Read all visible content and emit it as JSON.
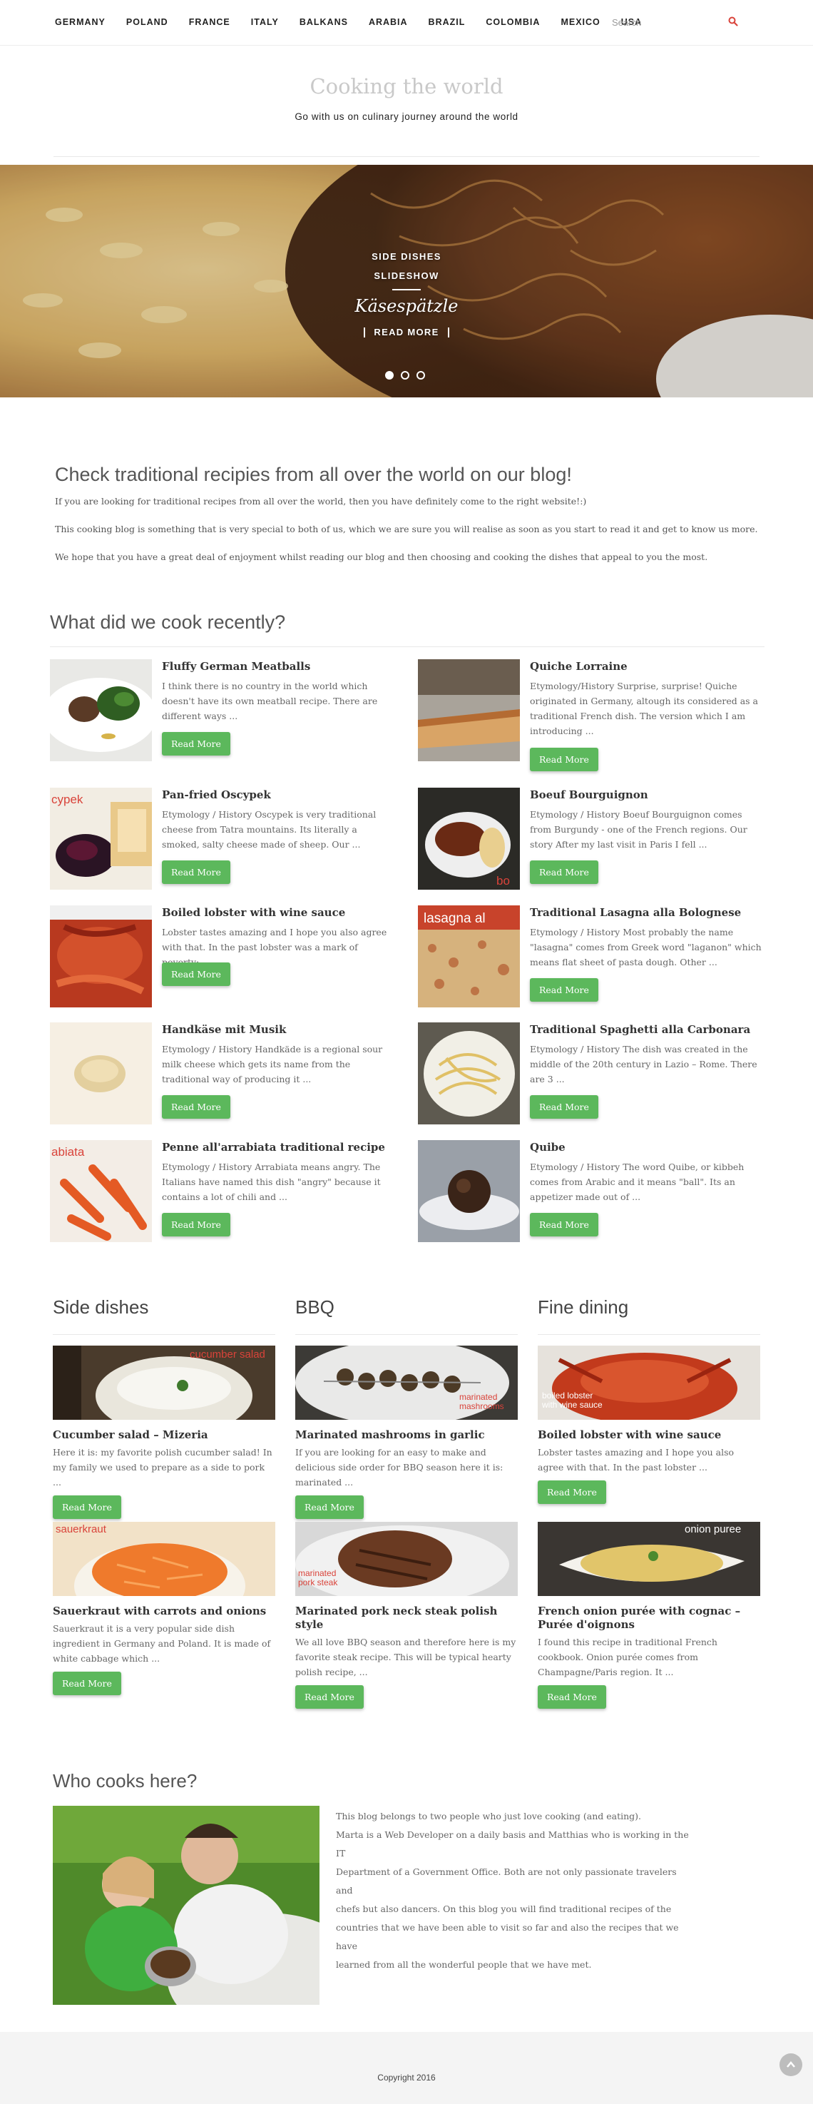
{
  "nav": {
    "items": [
      "GERMANY",
      "POLAND",
      "FRANCE",
      "ITALY",
      "BALKANS",
      "ARABIA",
      "BRAZIL",
      "COLOMBIA",
      "MEXICO",
      "USA"
    ],
    "search_placeholder": "Search",
    "search_icon": "search-icon"
  },
  "header": {
    "title": "Cooking the world",
    "tagline": "Go with us on culinary journey around the world"
  },
  "hero": {
    "category_1": "SIDE DISHES",
    "category_2": "SLIDESHOW",
    "title": "Käsespätzle",
    "read_more": "READ MORE",
    "slide_count": 3,
    "active_slide": 1
  },
  "intro": {
    "heading": "Check traditional recipies from all over the world on our blog!",
    "p1": "If you are looking for traditional recipes from all over the world, then you have definitely come to the right website!:)",
    "p2": "This cooking blog is something that is very special to both of us, which we are sure you will realise as soon as you start to read it and get to know us more.",
    "p3": "We hope that you have a great deal of enjoyment whilst reading our blog and then choosing and cooking the dishes that appeal to you the most."
  },
  "recent": {
    "heading": "What did we cook recently?",
    "button_label": "Read More",
    "left": [
      {
        "title": "Fluffy German Meatballs",
        "text": "I think there is no country in the world which doesn't have its own meatball recipe. There are different ways ..."
      },
      {
        "title": "Pan-fried Oscypek",
        "text": "Etymology / History Oscypek is very traditional cheese from Tatra mountains. Its literally a smoked, salty cheese made of sheep. Our ...",
        "img_label": "cypek"
      },
      {
        "title": "Boiled lobster with wine sauce",
        "text": "Lobster tastes amazing and I hope you also agree with that. In the past lobster was a mark of poverty: ..."
      },
      {
        "title": "Handkäse mit Musik",
        "text": "Etymology / History Handkäde is a regional sour milk cheese which gets its name from the traditional way of producing it ..."
      },
      {
        "title": "Penne all'arrabiata traditional recipe",
        "text": "Etymology / History Arrabiata means angry. The Italians have named this dish \"angry\" because it contains a lot of chili and ...",
        "img_label": "abiata"
      }
    ],
    "right": [
      {
        "title": "Quiche Lorraine",
        "text": "Etymology/History Surprise, surprise! Quiche originated in Germany, altough its considered as a traditional French dish. The version which I am introducing ..."
      },
      {
        "title": "Boeuf Bourguignon",
        "text": "Etymology / History Boeuf Bourguignon comes from Burgundy - one of the French regions. Our story After my last visit in Paris I fell ...",
        "img_label": "bo"
      },
      {
        "title": "Traditional Lasagna alla Bolognese",
        "text": "Etymology / History Most probably the name \"lasagna\" comes from Greek word \"laganon\" which means flat sheet of pasta dough. Other ...",
        "img_label": "lasagna al"
      },
      {
        "title": "Traditional Spaghetti alla Carbonara",
        "text": "Etymology / History The dish was created in the middle of the 20th century in Lazio – Rome. There are 3 ..."
      },
      {
        "title": "Quibe",
        "text": "Etymology / History The word Quibe, or kibbeh comes from Arabic and it means \"ball\". Its an appetizer made out of ..."
      }
    ]
  },
  "categories": [
    {
      "heading": "Side dishes",
      "posts": [
        {
          "title": "Cucumber salad – Mizeria",
          "text": "Here it is: my favorite polish cucumber salad! In my family we used to prepare as a side to pork ...",
          "img_label": "cucumber salad"
        },
        {
          "title": "Sauerkraut with carrots and onions",
          "text": "Sauerkraut it is a very popular side dish ingredient in Germany and Poland. It is made of white cabbage which ...",
          "img_label": "sauerkraut"
        }
      ]
    },
    {
      "heading": "BBQ",
      "posts": [
        {
          "title": "Marinated mashrooms in garlic",
          "text": "If you are looking for an easy to make and delicious side order for BBQ season here it is: marinated ...",
          "img_label_1": "marinated",
          "img_label_2": "mashrooms"
        },
        {
          "title": "Marinated pork neck steak polish style",
          "text": "We all love BBQ season and therefore here is my favorite steak recipe. This will be typical hearty polish recipe, ...",
          "img_label_1": "marinated",
          "img_label_2": "pork steak"
        }
      ]
    },
    {
      "heading": "Fine dining",
      "posts": [
        {
          "title": "Boiled lobster with wine sauce",
          "text": "Lobster tastes amazing and I hope you also agree with that. In the past lobster ...",
          "img_label_1": "boiled lobster",
          "img_label_2": "with wine sauce"
        },
        {
          "title": "French onion purée with cognac – Purée d'oignons",
          "text": "I found this recipe in traditional French cookbook. Onion purée comes from Champagne/Paris region. It ...",
          "img_label": "onion puree"
        }
      ]
    }
  ],
  "who": {
    "heading": "Who cooks here?",
    "lines": [
      "This blog belongs to two people who just love cooking (and eating).",
      "Marta is a Web Developer on a daily basis and Matthias who is working in the IT",
      "Department of a Government Office. Both are not only passionate travelers and",
      "chefs but also dancers. On this blog you will find traditional recipes of the",
      "countries that we have been able to visit so far and also the recipes that we have",
      "learned from all the wonderful people that we have met."
    ]
  },
  "footer": {
    "copyright": "Copyright 2016",
    "to_top_icon": "chevron-up-icon"
  },
  "colors": {
    "button_green": "#5cb85c",
    "search_icon_red": "#d9433a"
  }
}
